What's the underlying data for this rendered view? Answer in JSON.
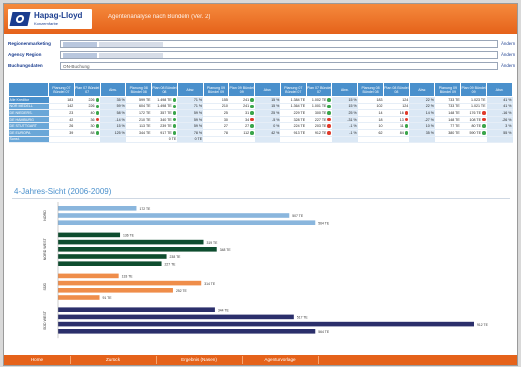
{
  "brand": {
    "name": "Hapag-Lloyd",
    "sub": "Konzernfarbe"
  },
  "app_title": "Agentenanalyse nach Bündeln (Ver. 2)",
  "filters": [
    {
      "label": "Regionenmarketing",
      "value": "",
      "button": "Ändern"
    },
    {
      "label": "Agency Region",
      "value": "",
      "button": "Ändern"
    },
    {
      "label": "Buchungsdaten",
      "value": "ON-Buchung",
      "button": "Ändern"
    }
  ],
  "colors": {
    "light_blue": "#8ab6dd",
    "dark_green": "#0e4d2f",
    "orange": "#ef8d4a",
    "navy": "#2b2f6b",
    "header_blue": "#4a90cc",
    "accent": "#e5621a"
  },
  "table": {
    "headers": [
      "",
      "Planung 07 Bündel 07",
      "Plan 07 Bündel 07",
      "Abw.",
      "Planung 08 Bündel 08",
      "Plan 08 Bündel 08",
      "Abw.",
      "Planung 09 Bündel 09",
      "Plan 09 Bündel 09",
      "Abw.",
      "Planung 07 Bündel 07",
      "Plan 07 Bündel 07",
      "Abw.",
      "Planung 08 Bündel 08",
      "Plan 08 Bündel 08",
      "Abw.",
      "Planung 09 Bündel 09",
      "Plan 09 Bündel 09",
      "Abw."
    ],
    "rows": [
      {
        "label": "Alle Kreditor",
        "cells": [
          "183",
          "226",
          "35 %",
          "599 TE",
          "1.498 TE",
          "71 %",
          "155",
          "241",
          "15 %",
          "1.384 TE",
          "1.002 TE",
          "15 %",
          "183",
          "124",
          "22 %",
          "733 TE",
          "1.023 TE",
          "41 %"
        ],
        "dots": [
          "",
          "green",
          "",
          "",
          "green",
          "",
          "",
          "green",
          "",
          "",
          "green",
          "",
          "",
          "",
          "",
          "",
          "",
          ""
        ]
      },
      {
        "label": "NOR MEDELL",
        "cells": [
          "142",
          "226",
          "59 %",
          "604 TE",
          "1.498 TE",
          "71 %",
          "210",
          "241",
          "15 %",
          "1.364 TE",
          "1.001 TE",
          "15 %",
          "102",
          "124",
          "22 %",
          "733 TE",
          "1.021 TE",
          "41 %"
        ],
        "dots": [
          "",
          "green",
          "",
          "",
          "green",
          "",
          "",
          "green",
          "",
          "",
          "green",
          "",
          "",
          "",
          "",
          "",
          "",
          ""
        ]
      },
      {
        "label": "DE NIEDERS.",
        "cells": [
          "23",
          "40",
          "58 %",
          "172 TE",
          "357 TE",
          "59 %",
          "25",
          "31",
          "25 %",
          "229 TE",
          "300 TE",
          "25 %",
          "14",
          "16",
          "14 %",
          "148 TE",
          "176 TE",
          "-16 %"
        ],
        "dots": [
          "",
          "green",
          "",
          "",
          "green",
          "",
          "",
          "green",
          "",
          "",
          "green",
          "",
          "",
          "red",
          "",
          "",
          "red",
          ""
        ]
      },
      {
        "label": "DE HAMBURG",
        "cells": [
          "42",
          "36",
          "-14 %",
          "210 TE",
          "340 TE",
          "59 %",
          "30",
          "34",
          "-5 %",
          "328 TE",
          "227 TE",
          "-31 %",
          "18",
          "13",
          "-27 %",
          "148 TE",
          "108 TE",
          "-26 %"
        ],
        "dots": [
          "",
          "red",
          "",
          "",
          "green",
          "",
          "",
          "red",
          "",
          "",
          "red",
          "",
          "",
          "red",
          "",
          "",
          "red",
          ""
        ]
      },
      {
        "label": "DE STUTTGART",
        "cells": [
          "26",
          "30",
          "15 %",
          "113 TE",
          "239 TE",
          "59 %",
          "27",
          "27",
          "0 %",
          "224 TE",
          "203 TE",
          "-1 %",
          "10",
          "11",
          "10 %",
          "77 TE",
          "80 TE",
          "3 %"
        ],
        "dots": [
          "",
          "green",
          "",
          "",
          "green",
          "",
          "",
          "green",
          "",
          "",
          "red",
          "",
          "",
          "green",
          "",
          "",
          "green",
          ""
        ]
      },
      {
        "label": "DE EUROPA",
        "cells": [
          "39",
          "88",
          "125 %",
          "344 TE",
          "917 TE",
          "78 %",
          "78",
          "112",
          "42 %",
          "913 TE",
          "912 TE",
          "-1 %",
          "62",
          "84",
          "35 %",
          "380 TE",
          "590 TE",
          "55 %"
        ],
        "dots": [
          "",
          "green",
          "",
          "",
          "green",
          "",
          "",
          "green",
          "",
          "",
          "red",
          "",
          "",
          "green",
          "",
          "",
          "green",
          ""
        ]
      },
      {
        "label": "Sonst.",
        "cells": [
          "",
          "",
          "",
          "",
          "0 TE",
          "0 TE",
          "",
          "",
          "",
          "",
          "",
          "",
          "",
          "",
          "",
          "",
          "",
          ""
        ],
        "dots": [
          "",
          "",
          "",
          "",
          "",
          "",
          "",
          "",
          "",
          "",
          "",
          "",
          "",
          "",
          "",
          "",
          "",
          ""
        ]
      }
    ]
  },
  "chart_title": "4-Jahres-Sicht (2006-2009)",
  "chart_data": {
    "type": "bar",
    "orientation": "horizontal",
    "title": "4-Jahres-Sicht (2006-2009)",
    "groups": [
      {
        "label": "NORD",
        "color": "#8ab6dd",
        "values": [
          172,
          507,
          564
        ],
        "value_labels": [
          "172 TE",
          "507 TE",
          "564 TE"
        ]
      },
      {
        "label": "NORD WEST",
        "color": "#0e4d2f",
        "values": [
          136,
          319,
          348,
          238,
          227
        ],
        "value_labels": [
          "136 TE",
          "319 TE",
          "348 TE",
          "238 TE",
          "227 TE"
        ]
      },
      {
        "label": "SÜD",
        "color": "#ef8d4a",
        "values": [
          133,
          314,
          252,
          91
        ],
        "value_labels": [
          "133 TE",
          "314 TE",
          "252 TE",
          "91 TE"
        ]
      },
      {
        "label": "SÜD WEST",
        "color": "#2b2f6b",
        "values": [
          344,
          517,
          912,
          564
        ],
        "value_labels": [
          "344 TE",
          "517 TE",
          "912 TE",
          "564 TE"
        ]
      }
    ]
  },
  "footer_tabs": [
    "Home",
    "Zurück",
    "Ergebnis (Nasen)",
    "Agenturvorlage"
  ]
}
